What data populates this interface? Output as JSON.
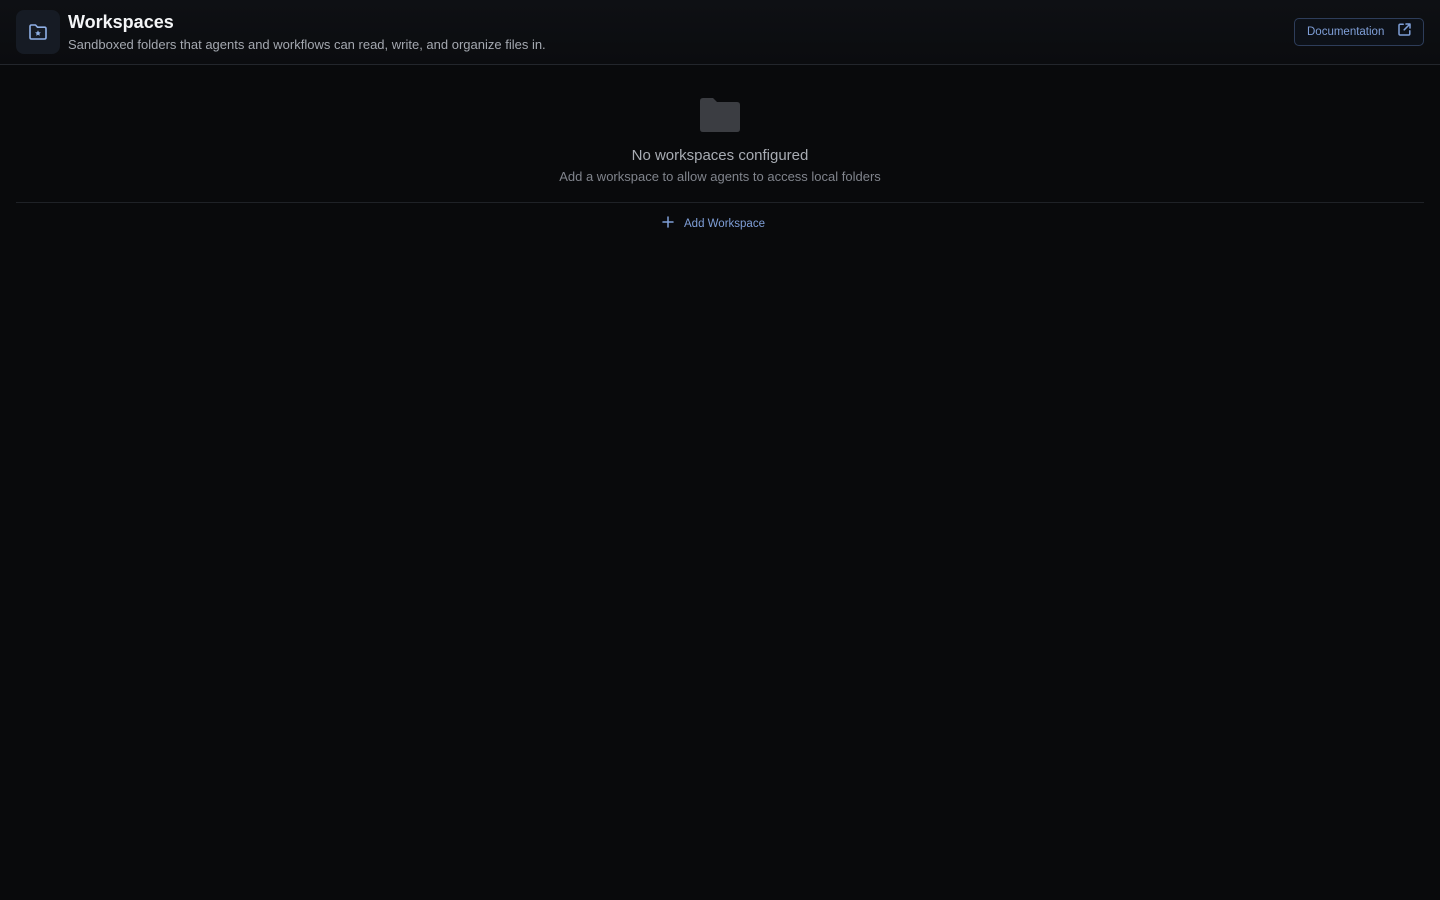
{
  "header": {
    "icon": "folder-star-icon",
    "title": "Workspaces",
    "subtitle": "Sandboxed folders that agents and workflows can read, write, and organize files in.",
    "documentation_label": "Documentation",
    "documentation_icon": "external-link-icon"
  },
  "empty_state": {
    "icon": "folder-icon",
    "title": "No workspaces configured",
    "description": "Add a workspace to allow agents to access local folders"
  },
  "actions": {
    "add_icon": "plus-icon",
    "add_label": "Add Workspace"
  },
  "colors": {
    "background": "#090a0c",
    "accent": "#7f9fd8",
    "muted_text": "#80848c"
  }
}
